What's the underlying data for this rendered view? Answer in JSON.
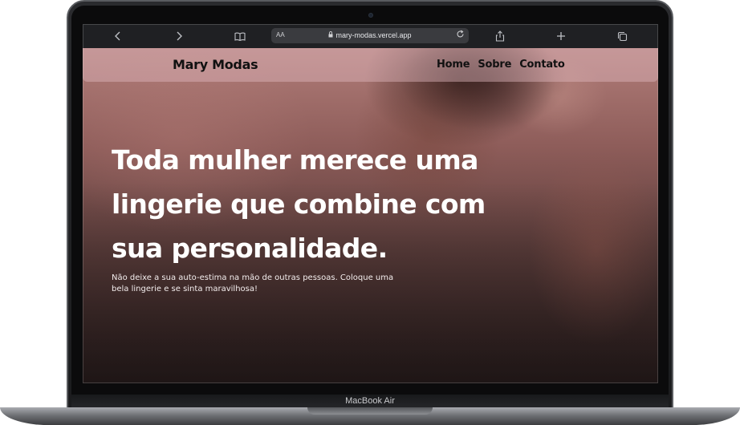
{
  "device": {
    "brand_label": "MacBook Air"
  },
  "browser": {
    "back_icon": "chevron-left-icon",
    "forward_icon": "chevron-right-icon",
    "reader_icon": "book-icon",
    "text_size_label": "AA",
    "url": "mary-modas.vercel.app",
    "lock_icon": "lock-icon",
    "reload_icon": "reload-icon",
    "share_icon": "share-icon",
    "new_tab_icon": "plus-icon",
    "tabs_icon": "tabs-icon"
  },
  "site": {
    "logo": "Mary Modas",
    "nav": [
      {
        "label": "Home"
      },
      {
        "label": "Sobre"
      },
      {
        "label": "Contato"
      }
    ],
    "hero": {
      "headline": "Toda mulher merece uma lingerie que combine com sua personalidade.",
      "subtext": "Não deixe a sua auto-estima na mão de outras pessoas. Coloque uma bela lingerie e se sinta maravilhosa!"
    }
  },
  "colors": {
    "nav_bg": "#e1b9be",
    "text_dark": "#111111",
    "text_light": "#ffffff",
    "toolbar_bg": "#1f2023"
  }
}
